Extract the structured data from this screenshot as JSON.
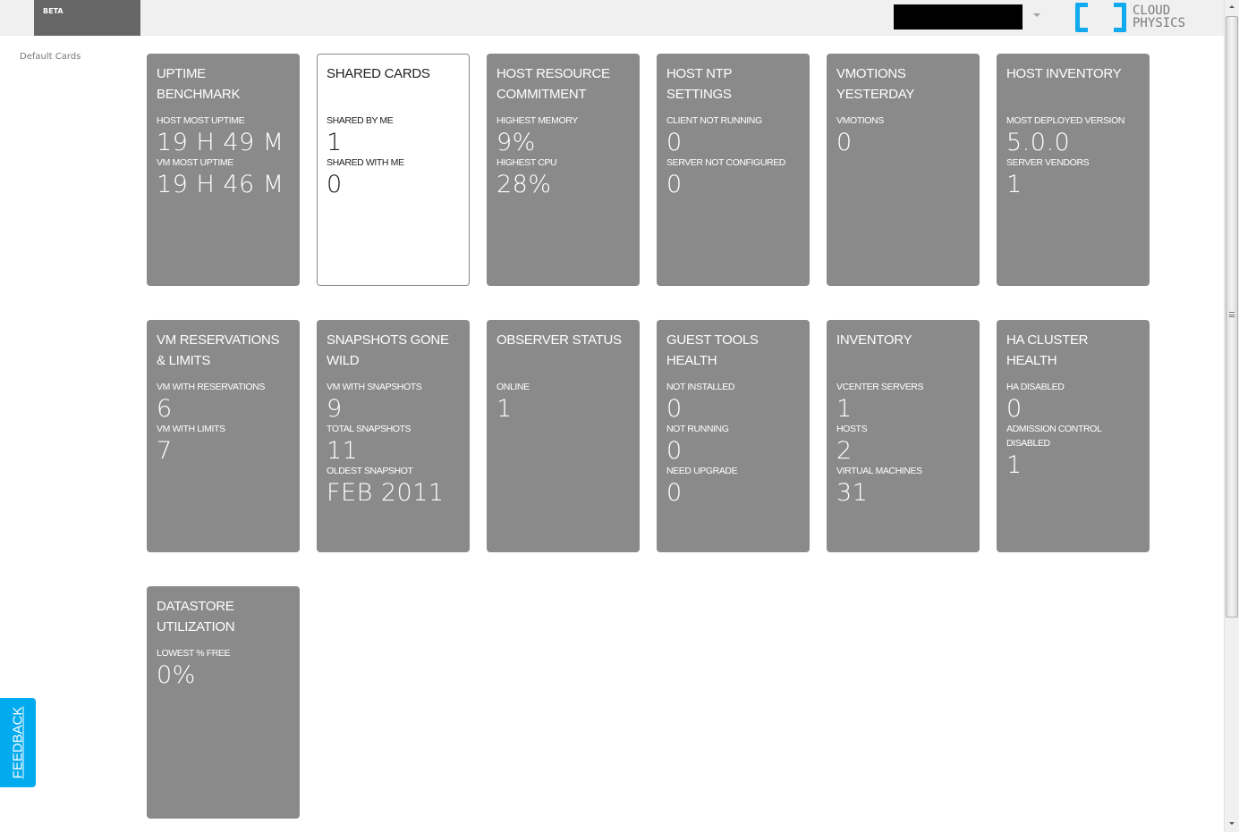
{
  "header": {
    "badge": "BETA",
    "account_menu": "account-redacted",
    "logo": {
      "line1": "CLOUD",
      "line2": "PHYSICS",
      "color": "#11aaee"
    }
  },
  "sidebar": {
    "default_cards_link": "Default Cards"
  },
  "cards": [
    {
      "title": "UPTIME BENCHMARK",
      "style": "gray",
      "metrics": [
        {
          "label": "HOST MOST UPTIME",
          "value": "19 H 49 M"
        },
        {
          "label": "VM MOST UPTIME",
          "value": "19 H 46 M"
        }
      ]
    },
    {
      "title": "SHARED CARDS",
      "style": "white",
      "metrics": [
        {
          "label": "SHARED BY ME",
          "value": "1"
        },
        {
          "label": "SHARED WITH ME",
          "value": "0"
        }
      ]
    },
    {
      "title": "HOST RESOURCE COMMITMENT",
      "style": "gray",
      "metrics": [
        {
          "label": "HIGHEST MEMORY",
          "value": "9%"
        },
        {
          "label": "HIGHEST CPU",
          "value": "28%"
        }
      ]
    },
    {
      "title": "HOST NTP SETTINGS",
      "style": "gray",
      "metrics": [
        {
          "label": "CLIENT NOT RUNNING",
          "value": "0"
        },
        {
          "label": "SERVER NOT CONFIGURED",
          "value": "0"
        }
      ]
    },
    {
      "title": "VMOTIONS YESTERDAY",
      "style": "gray",
      "metrics": [
        {
          "label": "VMOTIONS",
          "value": "0"
        }
      ]
    },
    {
      "title": "HOST INVENTORY",
      "style": "gray",
      "metrics": [
        {
          "label": "MOST DEPLOYED VERSION",
          "value": "5.0.0"
        },
        {
          "label": "SERVER VENDORS",
          "value": "1"
        }
      ]
    },
    {
      "title": "VM RESERVATIONS & LIMITS",
      "style": "gray",
      "metrics": [
        {
          "label": "VM WITH RESERVATIONS",
          "value": "6"
        },
        {
          "label": "VM WITH LIMITS",
          "value": "7"
        }
      ]
    },
    {
      "title": "SNAPSHOTS GONE WILD",
      "style": "gray",
      "metrics": [
        {
          "label": "VM WITH SNAPSHOTS",
          "value": "9"
        },
        {
          "label": "TOTAL SNAPSHOTS",
          "value": "11"
        },
        {
          "label": "OLDEST SNAPSHOT",
          "value": "FEB 2011"
        }
      ]
    },
    {
      "title": "OBSERVER STATUS",
      "style": "gray",
      "metrics": [
        {
          "label": "ONLINE",
          "value": "1"
        }
      ]
    },
    {
      "title": "GUEST TOOLS HEALTH",
      "style": "gray",
      "metrics": [
        {
          "label": "NOT INSTALLED",
          "value": "0"
        },
        {
          "label": "NOT RUNNING",
          "value": "0"
        },
        {
          "label": "NEED UPGRADE",
          "value": "0"
        }
      ]
    },
    {
      "title": "INVENTORY",
      "style": "gray",
      "metrics": [
        {
          "label": "VCENTER SERVERS",
          "value": "1"
        },
        {
          "label": "HOSTS",
          "value": "2"
        },
        {
          "label": "VIRTUAL MACHINES",
          "value": "31"
        }
      ]
    },
    {
      "title": "HA CLUSTER HEALTH",
      "style": "gray",
      "metrics": [
        {
          "label": "HA DISABLED",
          "value": "0"
        },
        {
          "label": "ADMISSION CONTROL DISABLED",
          "value": "1"
        }
      ]
    },
    {
      "title": "DATASTORE UTILIZATION",
      "style": "gray",
      "metrics": [
        {
          "label": "LOWEST % FREE",
          "value": "0%"
        }
      ]
    }
  ],
  "feedback": {
    "label": "FEEDBACK",
    "color": "#02aaee"
  }
}
